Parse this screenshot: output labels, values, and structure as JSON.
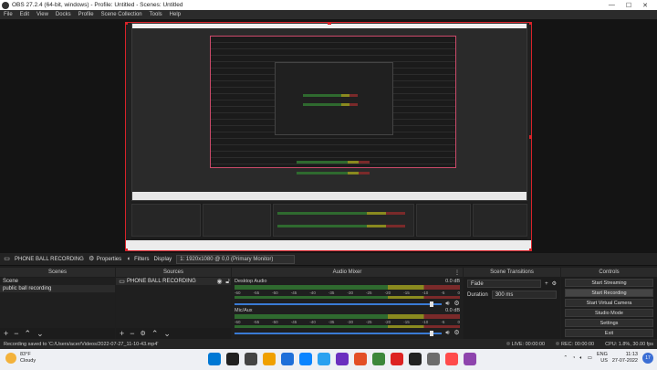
{
  "window": {
    "title": "OBS 27.2.4 (64-bit, windows) - Profile: Untitled - Scenes: Untitled",
    "controls": [
      "—",
      "☐",
      "✕"
    ]
  },
  "menu": [
    "File",
    "Edit",
    "View",
    "Docks",
    "Profile",
    "Scene Collection",
    "Tools",
    "Help"
  ],
  "source_toolbar": {
    "source_name": "PHONE BALL RECORDING",
    "properties_label": "Properties",
    "filters_label": "Filters",
    "display_label": "Display",
    "display_value": "1: 1920x1080 @ 0,0 (Primary Monitor)"
  },
  "scenes": {
    "title": "Scenes",
    "items": [
      "Scene",
      "public ball recording"
    ]
  },
  "sources": {
    "title": "Sources",
    "items": [
      "PHONE BALL RECORDING"
    ]
  },
  "mixer": {
    "title": "Audio Mixer",
    "ticks": [
      "-60",
      "-55",
      "-50",
      "-45",
      "-40",
      "-35",
      "-30",
      "-25",
      "-20",
      "-15",
      "-10",
      "-5",
      "0"
    ],
    "channels": [
      {
        "name": "Desktop Audio",
        "level": "0.0 dB",
        "meter_level": 0.72,
        "fader": 0.96
      },
      {
        "name": "Mic/Aux",
        "level": "0.0 dB",
        "meter_level": 0.7,
        "fader": 0.96
      }
    ]
  },
  "transitions": {
    "title": "Scene Transitions",
    "transition": "Fade",
    "duration_label": "Duration",
    "duration_value": "300 ms"
  },
  "controls": {
    "title": "Controls",
    "buttons": [
      "Start Streaming",
      "Start Recording",
      "Start Virtual Camera",
      "Studio Mode",
      "Settings",
      "Exit"
    ]
  },
  "status": {
    "recording_saved": "Recording saved to 'C:/Users/acer/Videos/2022-07-27_11-10-43.mp4'",
    "live": "LIVE: 00:00:00",
    "rec": "REC: 00:00:00",
    "cpu": "CPU: 1.8%, 30.00 fps"
  },
  "taskbar": {
    "weather_temp": "83°F",
    "weather_desc": "Cloudy",
    "lang_1": "ENG",
    "lang_2": "US",
    "time": "11:13",
    "date": "27-07-2022",
    "notification_count": "17",
    "app_colors": [
      "#0078d4",
      "#202020",
      "#444444",
      "#f0a000",
      "#1e6fd9",
      "#0a84ff",
      "#2aa1f0",
      "#6b2fbf",
      "#e34f26",
      "#3c873a",
      "#d22",
      "#222222",
      "#6c6c6c",
      "#ff4b4b",
      "#8e44ad"
    ]
  }
}
